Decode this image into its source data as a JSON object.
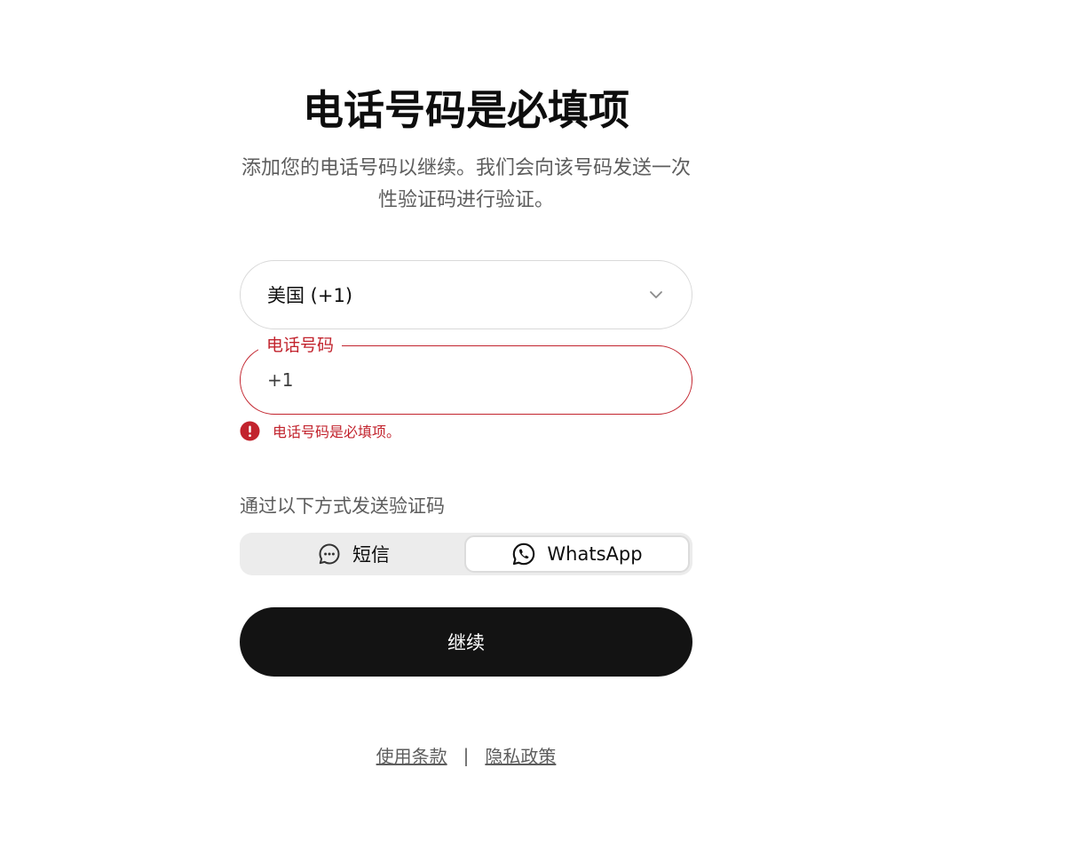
{
  "header": {
    "title": "电话号码是必填项",
    "subtitle": "添加您的电话号码以继续。我们会向该号码发送一次性验证码进行验证。"
  },
  "country_select": {
    "value": "美国 (+1)",
    "icon": "chevron-down-icon"
  },
  "phone_field": {
    "label": "电话号码",
    "value": "+1"
  },
  "error": {
    "message": "电话号码是必填项。",
    "icon": "alert-circle-icon",
    "color": "#c2232d"
  },
  "send_method": {
    "label": "通过以下方式发送验证码",
    "options": [
      {
        "label": "短信",
        "icon": "chat-bubble-icon",
        "selected": false
      },
      {
        "label": "WhatsApp",
        "icon": "whatsapp-icon",
        "selected": true
      }
    ]
  },
  "continue_button": {
    "label": "继续"
  },
  "footer": {
    "terms": "使用条款",
    "separator": "|",
    "privacy": "隐私政策"
  },
  "colors": {
    "primary_button": "#131313",
    "error": "#c2232d",
    "muted_text": "#5d5d5d"
  }
}
